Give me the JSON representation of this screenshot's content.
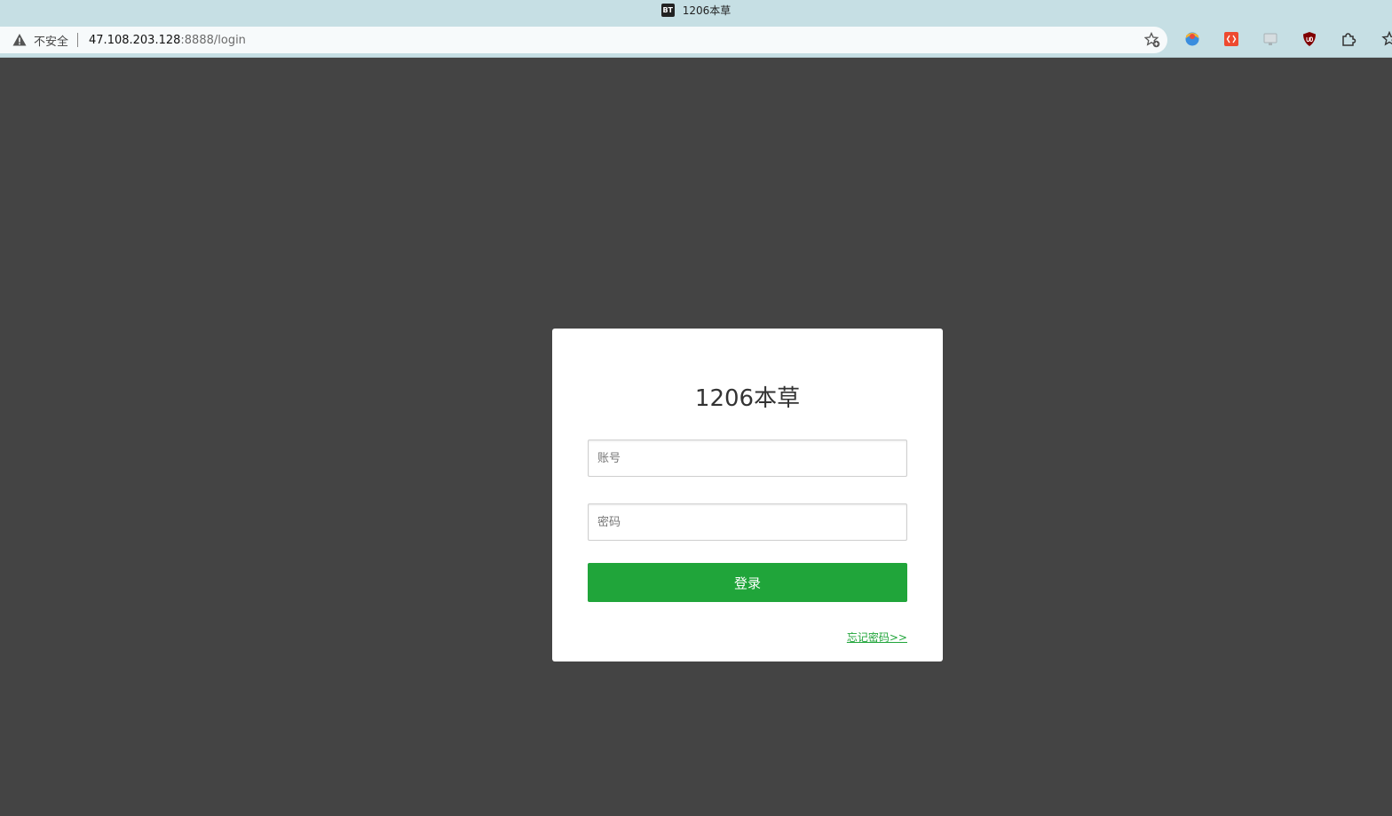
{
  "browser": {
    "tab_title": "1206本草",
    "tab_favicon_text": "BT",
    "security_label": "不安全",
    "url_host": "47.108.203.128",
    "url_rest": ":8888/login",
    "icons": [
      "warning-icon",
      "bookmark-add-icon",
      "extension-globe-icon",
      "extension-code-icon",
      "extension-screen-icon",
      "ublock-icon",
      "extensions-puzzle-icon",
      "bookmark-star-icon"
    ],
    "colors": {
      "chrome_bg": "#c6dfe4",
      "omnibox_bg": "#f7fafb"
    }
  },
  "login": {
    "title": "1206本草",
    "username_placeholder": "账号",
    "password_placeholder": "密码",
    "submit_label": "登录",
    "forgot_label": "忘记密码>>",
    "colors": {
      "accent": "#20a53a",
      "page_bg": "#444444",
      "card_bg": "#ffffff"
    }
  }
}
